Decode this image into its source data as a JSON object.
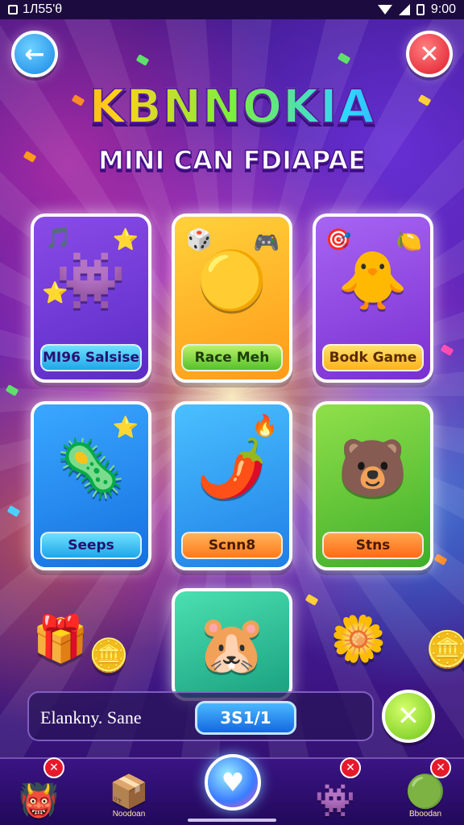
{
  "status_bar": {
    "time_left": "1Л55'θ",
    "time_right": "9:00"
  },
  "header": {
    "title": "KBNNOKIA",
    "subtitle": "MINI CAN FDIAPAE"
  },
  "games": [
    {
      "label": "MI96 Salsise",
      "icon": "puzzle-creature-icon"
    },
    {
      "label": "Race Meh",
      "icon": "bouncing-ball-icon"
    },
    {
      "label": "Bodk Game",
      "icon": "winged-mascot-icon"
    },
    {
      "label": "Seeps",
      "icon": "purple-blob-icon"
    },
    {
      "label": "Scnn8",
      "icon": "red-fire-creature-icon"
    },
    {
      "label": "Stns",
      "icon": "blue-bear-icon"
    }
  ],
  "search": {
    "placeholder": "Elankny. Sane",
    "value_pill": "3S1/1"
  },
  "nav": {
    "items": [
      {
        "label": "",
        "icon": "orange-monster-icon"
      },
      {
        "label": "Noodoan",
        "icon": "treasure-box-icon"
      },
      {
        "label": "",
        "icon": "blue-monster-icon"
      },
      {
        "label": "Bboodan",
        "icon": "green-stack-icon"
      }
    ]
  },
  "colors": {
    "accent": "#1688e6",
    "close": "#e01a2b",
    "confirm": "#6cc51a"
  }
}
